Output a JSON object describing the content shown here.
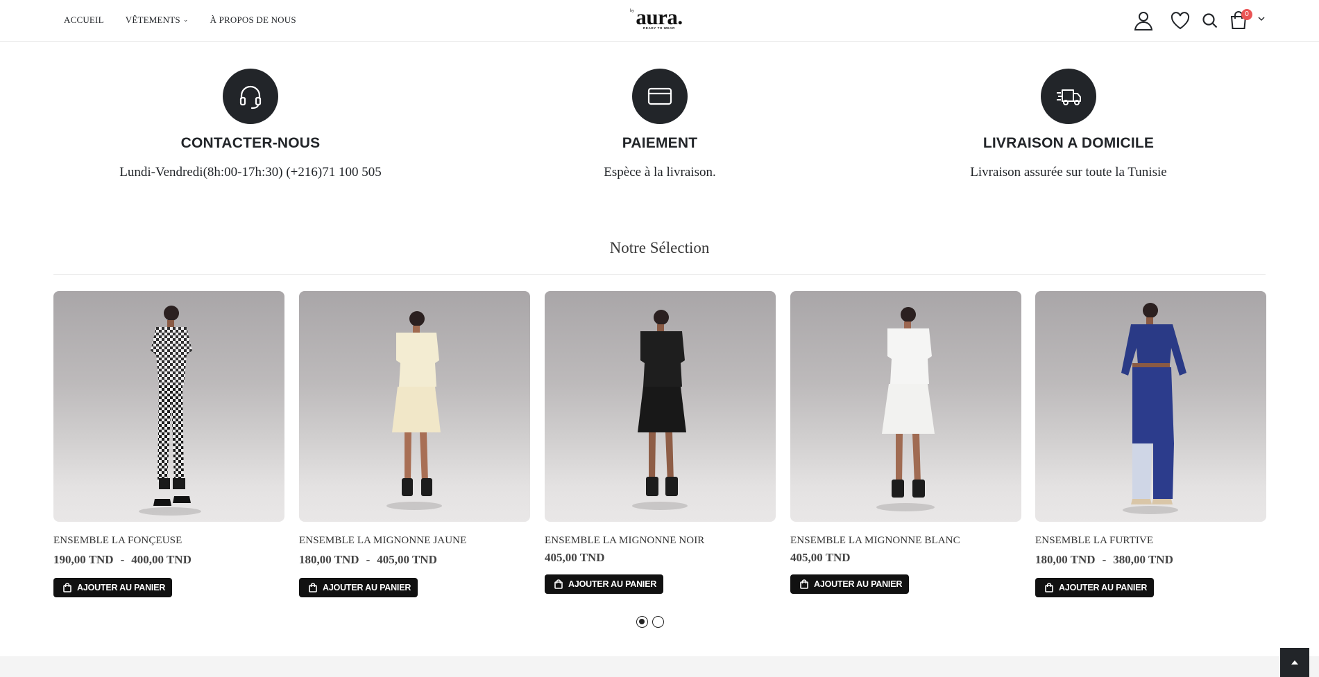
{
  "header": {
    "nav": [
      {
        "label": "ACCUEIL",
        "has_dropdown": false
      },
      {
        "label": "VÊTEMENTS",
        "has_dropdown": true
      },
      {
        "label": "À PROPOS DE NOUS",
        "has_dropdown": false
      }
    ],
    "logo": {
      "by": "by",
      "name": "aura.",
      "tagline": "READY TO WEAR"
    },
    "icons": [
      "user-icon",
      "heart-icon",
      "search-icon",
      "cart-icon"
    ],
    "cart_count": "0"
  },
  "features": [
    {
      "icon": "headset-icon",
      "title": "CONTACTER-NOUS",
      "text": "Lundi-Vendredi(8h:00-17h:30) (+216)71 100 505"
    },
    {
      "icon": "credit-card-icon",
      "title": "PAIEMENT",
      "text": "Espèce à la livraison."
    },
    {
      "icon": "delivery-truck-icon",
      "title": "LIVRAISON A DOMICILE",
      "text": "Livraison assurée sur toute la Tunisie"
    }
  ],
  "section": {
    "title": "Notre Sélection"
  },
  "products": [
    {
      "name": "ENSEMBLE LA FONÇEUSE",
      "price_from": "190,00 TND",
      "price_sep": "-",
      "price_to": "400,00 TND",
      "button": "AJOUTER AU PANIER"
    },
    {
      "name": "ENSEMBLE LA MIGNONNE JAUNE",
      "price_from": "180,00 TND",
      "price_sep": "-",
      "price_to": "405,00 TND",
      "button": "AJOUTER AU PANIER"
    },
    {
      "name": "ENSEMBLE LA MIGNONNE NOIR",
      "price_from": "405,00 TND",
      "price_sep": "",
      "price_to": "",
      "button": "AJOUTER AU PANIER"
    },
    {
      "name": "ENSEMBLE LA MIGNONNE BLANC",
      "price_from": "405,00 TND",
      "price_sep": "",
      "price_to": "",
      "button": "AJOUTER AU PANIER"
    },
    {
      "name": "ENSEMBLE LA FURTIVE",
      "price_from": "180,00 TND",
      "price_sep": "-",
      "price_to": "380,00 TND",
      "button": "AJOUTER AU PANIER"
    }
  ],
  "carousel": {
    "pages": 2,
    "active": 1
  },
  "colors": {
    "dark": "#222529",
    "badge": "#ea5455",
    "button": "#111111",
    "footer": "#f4f4f4"
  }
}
